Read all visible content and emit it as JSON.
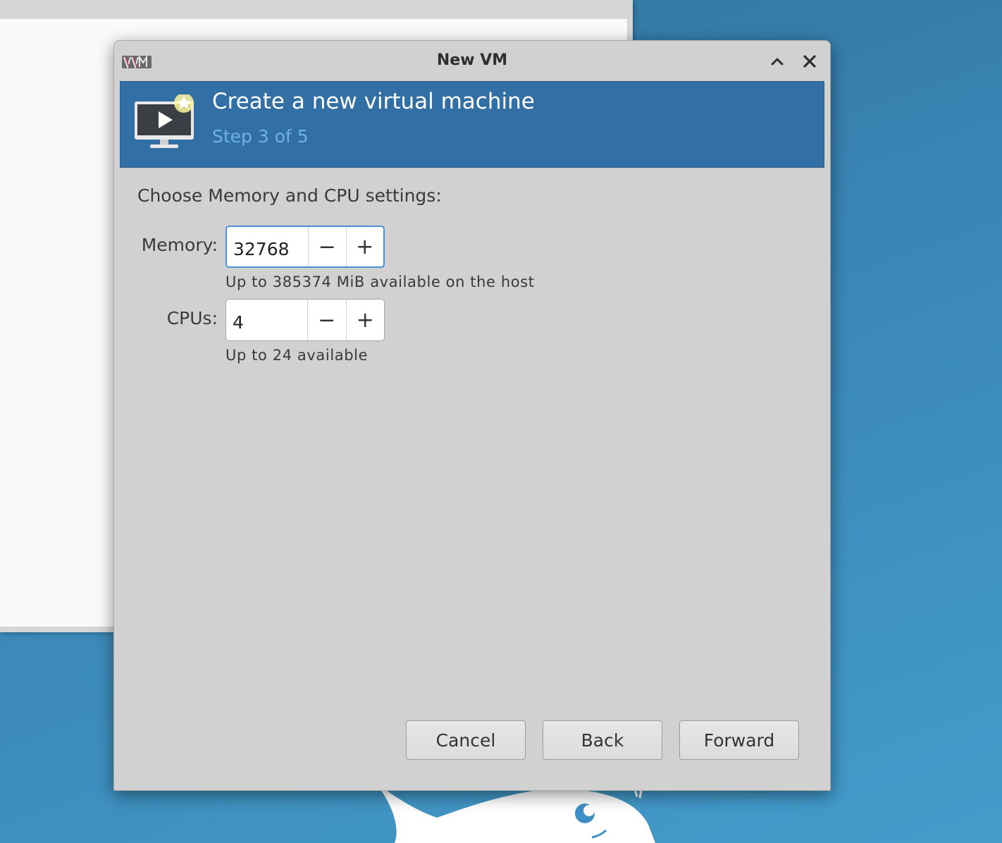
{
  "window": {
    "title": "New VM"
  },
  "banner": {
    "title": "Create a new virtual machine",
    "step": "Step 3 of 5"
  },
  "content": {
    "heading": "Choose Memory and CPU settings:",
    "memory": {
      "label": "Memory:",
      "value": "32768",
      "hint": "Up to 385374 MiB available on the host"
    },
    "cpus": {
      "label": "CPUs:",
      "value": "4",
      "hint": "Up to 24 available"
    },
    "decrement_symbol": "−",
    "increment_symbol": "+"
  },
  "buttons": {
    "cancel": "Cancel",
    "back": "Back",
    "forward": "Forward"
  },
  "icons": {
    "app_logo": "virt-manager-logo-icon",
    "maximize": "chevron-up-icon",
    "close": "close-icon",
    "banner": "vm-monitor-play-icon"
  },
  "colors": {
    "banner": "#326fa4",
    "step_text": "#6fb0e8",
    "focus": "#4a90d9",
    "dialog_bg": "#d1d1d1"
  }
}
